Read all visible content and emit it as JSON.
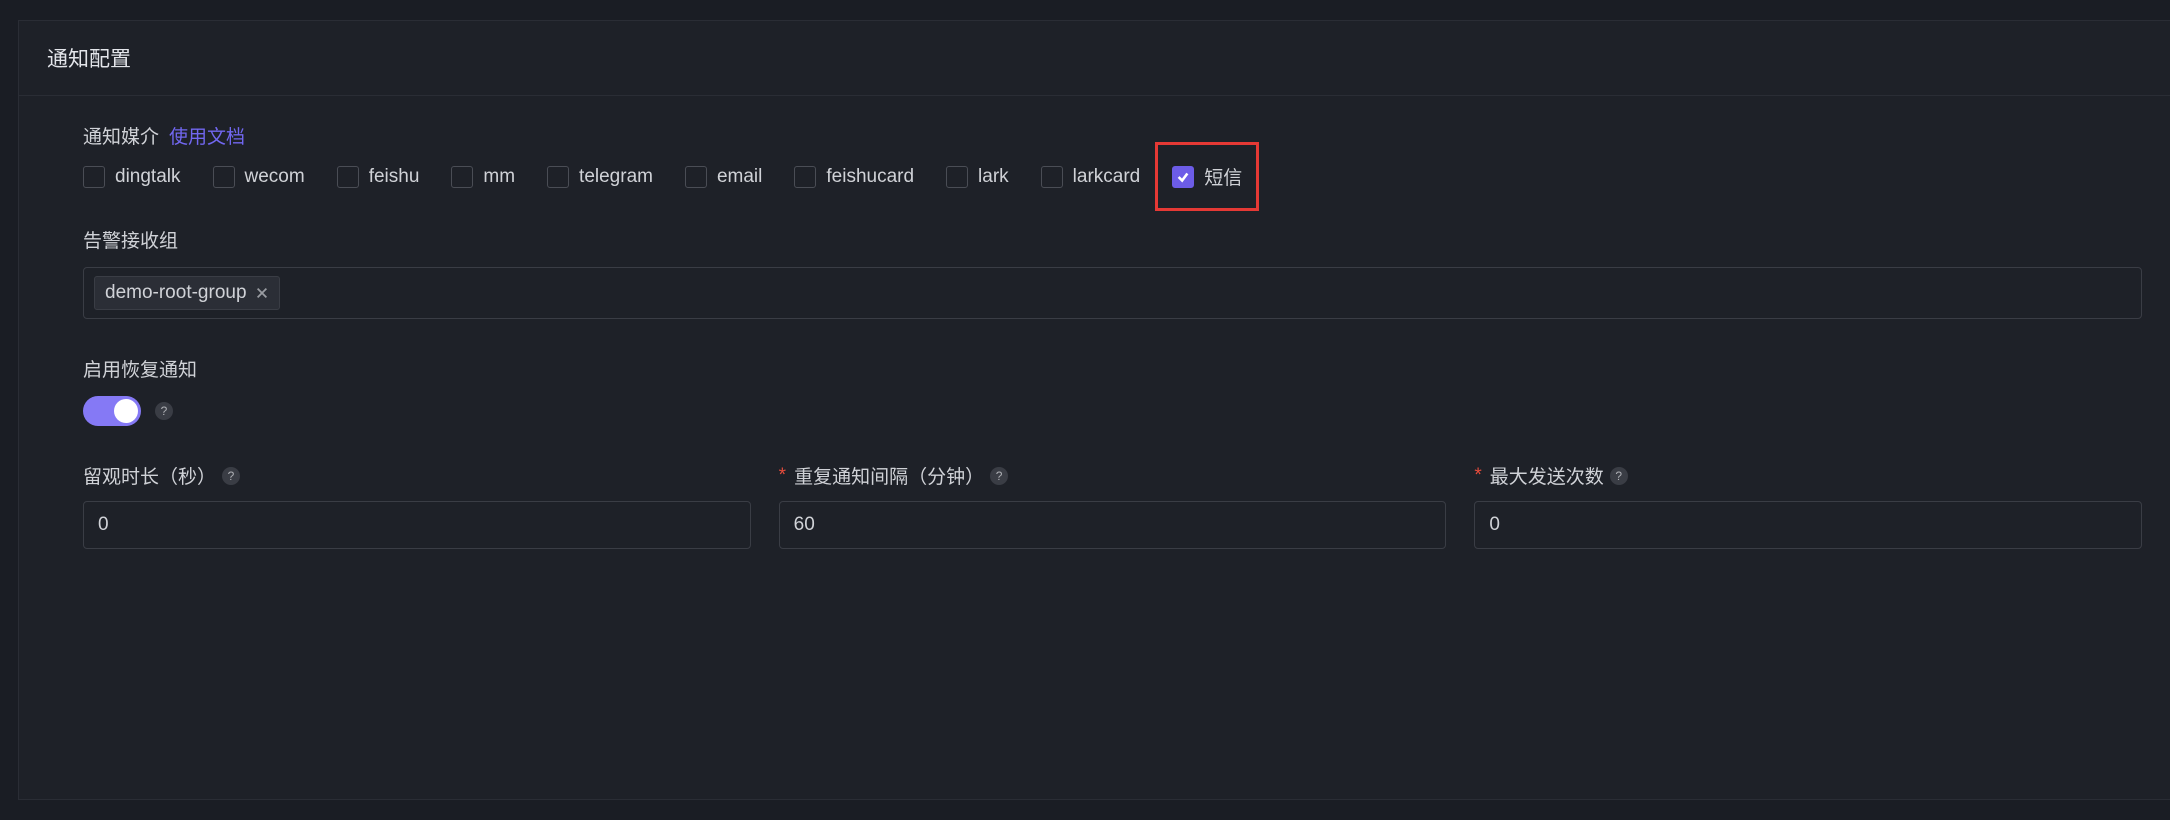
{
  "panel": {
    "title": "通知配置"
  },
  "media": {
    "label": "通知媒介",
    "doc_link": "使用文档",
    "options": [
      {
        "key": "dingtalk",
        "label": "dingtalk",
        "checked": false
      },
      {
        "key": "wecom",
        "label": "wecom",
        "checked": false
      },
      {
        "key": "feishu",
        "label": "feishu",
        "checked": false
      },
      {
        "key": "mm",
        "label": "mm",
        "checked": false
      },
      {
        "key": "telegram",
        "label": "telegram",
        "checked": false
      },
      {
        "key": "email",
        "label": "email",
        "checked": false
      },
      {
        "key": "feishucard",
        "label": "feishucard",
        "checked": false
      },
      {
        "key": "lark",
        "label": "lark",
        "checked": false
      },
      {
        "key": "larkcard",
        "label": "larkcard",
        "checked": false
      },
      {
        "key": "sms",
        "label": "短信",
        "checked": true,
        "highlighted": true
      }
    ]
  },
  "recv_group": {
    "label": "告警接收组",
    "tags": [
      "demo-root-group"
    ]
  },
  "recovery": {
    "label": "启用恢复通知",
    "enabled": true
  },
  "observe": {
    "label": "留观时长（秒）",
    "required": false,
    "value": "0"
  },
  "repeat": {
    "label": "重复通知间隔（分钟）",
    "required": true,
    "value": "60"
  },
  "max_send": {
    "label": "最大发送次数",
    "required": true,
    "value": "0"
  }
}
